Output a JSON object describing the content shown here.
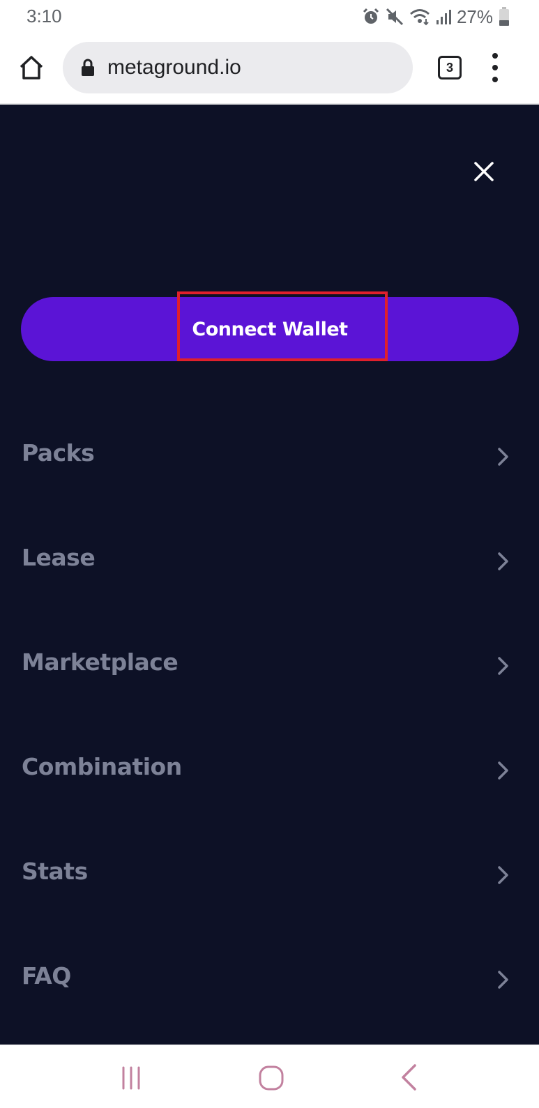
{
  "status_bar": {
    "time": "3:10",
    "battery": "27%",
    "icons": [
      "alarm-icon",
      "mute-icon",
      "wifi-icon",
      "signal-icon",
      "battery-icon"
    ]
  },
  "browser": {
    "url": "metaground.io",
    "tab_count": "3",
    "icons": [
      "home-icon",
      "lock-icon",
      "tabs-icon",
      "more-vert-icon"
    ]
  },
  "menu": {
    "close_icon": "close-icon",
    "connect_wallet_label": "Connect Wallet",
    "items": [
      {
        "label": "Packs"
      },
      {
        "label": "Lease"
      },
      {
        "label": "Marketplace"
      },
      {
        "label": "Combination"
      },
      {
        "label": "Stats"
      },
      {
        "label": "FAQ"
      }
    ]
  },
  "android_nav": {
    "icons": [
      "recent-apps-icon",
      "home-icon",
      "back-icon"
    ]
  },
  "colors": {
    "background": "#0d1126",
    "accent": "#5b14d6",
    "menu_text": "#7d8297",
    "highlight": "#e0202c",
    "nav_icon": "#c2819f"
  }
}
